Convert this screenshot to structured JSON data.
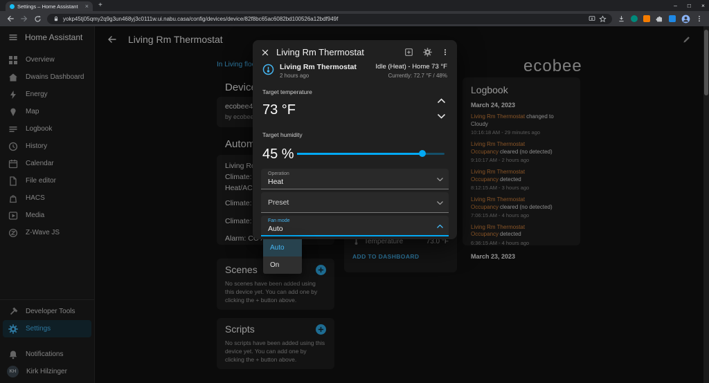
{
  "browser": {
    "tab_title": "Settings – Home Assistant",
    "tab_close": "×",
    "new_tab_label": "+",
    "url": "yokp45tj05qmy2q9g3un468yj3c0111w.ui.nabu.casa/config/devices/device/82f8bc65ac6082bd100526a12bdf949f",
    "window_controls": {
      "minimize": "–",
      "maximize": "□",
      "close": "×"
    }
  },
  "sidebar": {
    "title": "Home Assistant",
    "items": [
      {
        "label": "Overview"
      },
      {
        "label": "Dwains Dashboard"
      },
      {
        "label": "Energy"
      },
      {
        "label": "Map"
      },
      {
        "label": "Logbook"
      },
      {
        "label": "History"
      },
      {
        "label": "Calendar"
      },
      {
        "label": "File editor"
      },
      {
        "label": "HACS"
      },
      {
        "label": "Media"
      },
      {
        "label": "Z-Wave JS"
      }
    ],
    "bottom_items": [
      {
        "label": "Developer Tools"
      },
      {
        "label": "Settings"
      },
      {
        "label": "Notifications"
      }
    ],
    "user": {
      "name": "Kirk Hilzinger",
      "initials": "KH"
    }
  },
  "header": {
    "title": "Living Rm Thermostat"
  },
  "page": {
    "breadcrumb": "In Living floor",
    "device": {
      "heading": "Device",
      "name": "ecobee4 Sm",
      "vendor": "by ecobee"
    },
    "automations": {
      "heading": "Automati",
      "rows": [
        "Living Room",
        "Climate: Wir",
        "Heat/AC",
        "Climate: Ho",
        "Climate: Ho",
        "Alarm: CO A"
      ]
    },
    "scenes": {
      "heading": "Scenes",
      "empty_text": "No scenes have been added using this device yet. You can add one by clicking the + button above."
    },
    "scripts": {
      "heading": "Scripts",
      "empty_text": "No scripts have been added using this device yet. You can add one by clicking the + button above."
    },
    "sensors": {
      "row_label": "Temperature",
      "row_value": "73.0 °F",
      "add_to_dashboard": "ADD TO DASHBOARD"
    },
    "brand": "ecobee"
  },
  "logbook": {
    "title": "Logbook",
    "date_top": "March 24, 2023",
    "date_bottom": "March 23, 2023",
    "entries": [
      {
        "entity": "Living Rm Thermostat",
        "action": "changed to Cloudy",
        "time": "10:16:18 AM - 29 minutes ago"
      },
      {
        "entity": "Living Rm Thermostat Occupancy",
        "action": "cleared (no detected)",
        "time": "9:10:17 AM - 2 hours ago"
      },
      {
        "entity": "Living Rm Thermostat Occupancy",
        "action": "detected",
        "time": "8:12:15 AM - 3 hours ago"
      },
      {
        "entity": "Living Rm Thermostat Occupancy",
        "action": "cleared (no detected)",
        "time": "7:06:15 AM - 4 hours ago"
      },
      {
        "entity": "Living Rm Thermostat Occupancy",
        "action": "detected",
        "time": "6:36:15 AM - 4 hours ago"
      }
    ]
  },
  "dialog": {
    "title": "Living Rm Thermostat",
    "entity_name": "Living Rm Thermostat",
    "last_changed": "2 hours ago",
    "state": "Idle (Heat) - Home 73 °F",
    "currently": "Currently: 72.7 °F / 48%",
    "target_temperature": {
      "label": "Target temperature",
      "value": "73 °F"
    },
    "target_humidity": {
      "label": "Target humidity",
      "value": "45 %",
      "percent": 45
    },
    "operation": {
      "label": "Operation",
      "value": "Heat"
    },
    "preset": {
      "label": "Preset"
    },
    "fan_mode": {
      "label": "Fan mode",
      "value": "Auto"
    },
    "fan_menu": {
      "options": [
        "Auto",
        "On"
      ],
      "selected": "Auto"
    }
  },
  "colors": {
    "accent": "#03a9f4",
    "logbook_link": "#d2823c"
  }
}
